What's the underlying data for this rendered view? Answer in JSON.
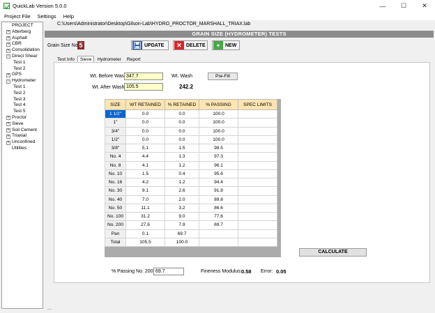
{
  "window": {
    "title": "QuickLab  Version 5.0.0",
    "min_glyph": "—",
    "max_glyph": "☐",
    "close_glyph": "✕"
  },
  "menu": [
    "Project File",
    "Settings",
    "Help"
  ],
  "tree": [
    {
      "label": "PROJECT",
      "level": 0,
      "expander": ""
    },
    {
      "label": "Atterberg",
      "level": 0,
      "expander": "+"
    },
    {
      "label": "Asphalt",
      "level": 0,
      "expander": "+"
    },
    {
      "label": "CBR",
      "level": 0,
      "expander": "+"
    },
    {
      "label": "Consolidation",
      "level": 0,
      "expander": "+"
    },
    {
      "label": "Direct Shear",
      "level": 0,
      "expander": "−"
    },
    {
      "label": "Test 1",
      "level": 1,
      "expander": ""
    },
    {
      "label": "Test 2",
      "level": 1,
      "expander": ""
    },
    {
      "label": "GPS",
      "level": 0,
      "expander": "+"
    },
    {
      "label": "Hydrometer",
      "level": 0,
      "expander": "−"
    },
    {
      "label": "Test 1",
      "level": 1,
      "expander": ""
    },
    {
      "label": "Test 2",
      "level": 1,
      "expander": ""
    },
    {
      "label": "Test 3",
      "level": 1,
      "expander": ""
    },
    {
      "label": "Test 4",
      "level": 1,
      "expander": ""
    },
    {
      "label": "Test 5",
      "level": 1,
      "expander": ""
    },
    {
      "label": "Proctor",
      "level": 0,
      "expander": "+"
    },
    {
      "label": "Sieve",
      "level": 0,
      "expander": "+"
    },
    {
      "label": "Soil Cement",
      "level": 0,
      "expander": "+"
    },
    {
      "label": "Triaxial",
      "level": 0,
      "expander": "+"
    },
    {
      "label": "Unconfined",
      "level": 0,
      "expander": "+"
    },
    {
      "label": "Utilities",
      "level": 0,
      "expander": ""
    }
  ],
  "file_path": "C:\\Users\\Administrator\\Desktop\\Gilson-Lab\\HYDRO_PROCTOR_MARSHALL_TRIAX.lab",
  "panel_title": "GRAIN SIZE (HYDROMETER) TESTS",
  "grain_size": {
    "label": "Grain Size No:",
    "value": "5"
  },
  "buttons": {
    "update": "UPDATE",
    "delete": "DELETE",
    "new": "NEW",
    "prefill": "Pre-Fill",
    "calculate": "CALCULATE"
  },
  "icons": {
    "update": "save-disk-icon",
    "delete": "red-x-icon",
    "new": "green-plus-icon"
  },
  "colors": {
    "update": "#2d5fa8",
    "delete": "#d6262c",
    "new": "#45a845",
    "selected": "#0a66d0",
    "header": "#fde4b0"
  },
  "tabs": [
    "Test Info",
    "Sieve",
    "Hydrometer",
    "Report"
  ],
  "active_tab": "Sieve",
  "wash": {
    "before_label": "Wt. Before Wash",
    "before_value": "347.7",
    "after_label": "Wt. After Wash",
    "after_value": "105.5",
    "wash_label": "Wt. Wash",
    "wash_value": "242.2"
  },
  "table": {
    "headers": [
      "SIZE",
      "WT RETAINED",
      "% RETAINED",
      "% PASSING",
      "SPEC LIMITS"
    ],
    "rows": [
      [
        "1 1/2\"",
        "0.0",
        "0.0",
        "100.0",
        ""
      ],
      [
        "1\"",
        "0.0",
        "0.0",
        "100.0",
        ""
      ],
      [
        "3/4\"",
        "0.0",
        "0.0",
        "100.0",
        ""
      ],
      [
        "1/2\"",
        "0.0",
        "0.0",
        "100.0",
        ""
      ],
      [
        "3/8\"",
        "5.1",
        "1.5",
        "98.5",
        ""
      ],
      [
        "No. 4",
        "4.4",
        "1.3",
        "97.3",
        ""
      ],
      [
        "No. 8",
        "4.1",
        "1.2",
        "96.1",
        ""
      ],
      [
        "No. 10",
        "1.5",
        "0.4",
        "95.6",
        ""
      ],
      [
        "No. 16",
        "4.2",
        "1.2",
        "94.4",
        ""
      ],
      [
        "No. 30",
        "9.1",
        "2.6",
        "91.8",
        ""
      ],
      [
        "No. 40",
        "7.0",
        "2.0",
        "89.8",
        ""
      ],
      [
        "No. 50",
        "11.1",
        "3.2",
        "86.6",
        ""
      ],
      [
        "No. 100",
        "31.2",
        "9.0",
        "77.6",
        ""
      ],
      [
        "No. 200",
        "27.6",
        "7.9",
        "69.7",
        ""
      ],
      [
        "Pan",
        "0.1",
        "69.7",
        "",
        ""
      ],
      [
        "Total",
        "105.5",
        "100.0",
        "",
        ""
      ]
    ]
  },
  "results": {
    "passing_label": "% Passing No. 200:",
    "passing_value": "69.7",
    "fineness_label": "Fineness Modulus:",
    "fineness_value": "0.58",
    "error_label": "Error:",
    "error_value": "0.05"
  },
  "status_text": "..."
}
